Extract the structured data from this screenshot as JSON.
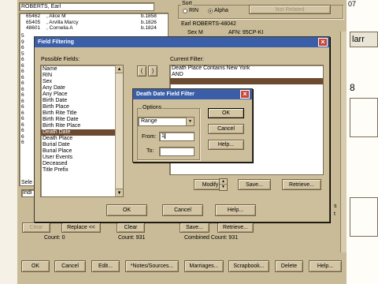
{
  "background": {
    "person_header": "ROBERTS, Earl",
    "people": [
      {
        "id": "65462",
        "name": "Alice M",
        "date": "b.1858"
      },
      {
        "id": "65405",
        "name": "Arvilla Marcy",
        "date": "b.1826"
      },
      {
        "id": "48601",
        "name": "Cornelia A",
        "date": "b.1824"
      }
    ],
    "people_left_fragments": [
      "5",
      "9",
      "6",
      "5",
      "6",
      "6",
      "6",
      "6",
      "6",
      "6",
      "6",
      "6",
      "6",
      "6",
      "6",
      "6",
      "6",
      "6",
      "6"
    ],
    "sel_label": "Sele",
    "indi_label": "Indi",
    "sort_label": "Sort",
    "sort_rin": "RIN",
    "sort_alpha": "Alpha",
    "not_related": "Not Related",
    "earl_header": "Earl ROBERTS-48042",
    "sex_label": "Sex M",
    "afn_label": "AFN: 95CP-KI",
    "clear_left": "Clear",
    "replace_label": "Replace <<",
    "count_left": "Count: 0",
    "clear_mid": "Clear",
    "count_mid": "Count: 931",
    "save_label": "Save...",
    "retrieve_label": "Retrieve...",
    "combined_count": "Combined Count: 931",
    "right_edge_top": "07",
    "right_edge_mid": "8",
    "right_edge_tab": "larr",
    "right_edge_fragment_1": "s",
    "right_edge_fragment_2": "t",
    "bottom_buttons": [
      "OK",
      "Cancel",
      "Edit...",
      "*Notes/Sources...",
      "Marriages...",
      "Scrapbook...",
      "Delete",
      "Help..."
    ]
  },
  "field_filtering": {
    "title": "Field Filtering",
    "possible_label": "Possible Fields:",
    "fields": [
      "Name",
      "RIN",
      "Sex",
      "Any Date",
      "Any Place",
      "Birth Date",
      "Birth Place",
      "Birth Rite Title",
      "Birth Rite Date",
      "Birth Rite Place",
      "Death Date",
      "Death Place",
      "Burial Date",
      "Burial Place",
      "User Events",
      "Deceased",
      "Title Prefix"
    ],
    "selected_field": "Death Date",
    "paren_open": "(",
    "paren_close": ")",
    "current_label": "Current Filter:",
    "current_lines": [
      "Death Place Contains New York",
      "AND",
      ""
    ],
    "modify": "Modify",
    "save": "Save...",
    "retrieve": "Retrieve...",
    "ok": "OK",
    "cancel": "Cancel",
    "help": "Help..."
  },
  "date_filter": {
    "title": "Death Date Field Filter",
    "options_label": "Options",
    "select_value": "Range",
    "from_label": "From:",
    "from_value": "1",
    "to_label": "To:",
    "to_value": "",
    "ok": "OK",
    "cancel": "Cancel",
    "help": "Help..."
  },
  "colors": {
    "titlebar": "#3a5fa8",
    "selection": "#6b4a30",
    "close": "#c8463a",
    "panel": "#cdbf9c"
  }
}
